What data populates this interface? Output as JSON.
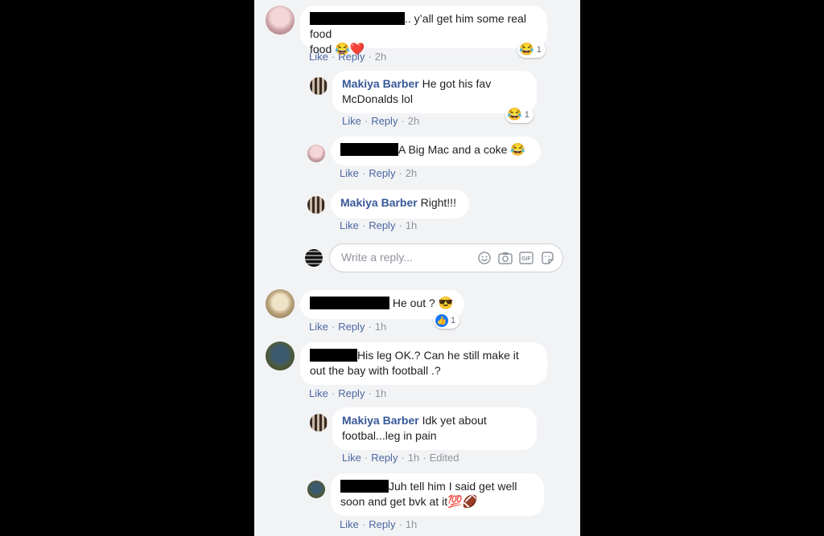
{
  "colors": {
    "page_bg": "#000000",
    "panel_bg": "#f2f3f5",
    "author": "#385898",
    "action": "#4b67a1",
    "meta": "#90949c"
  },
  "actions": {
    "like": "Like",
    "reply": "Reply",
    "separator": "·"
  },
  "comments": [
    {
      "text": ".. y’all get him some real food",
      "emoji": "😂❤️",
      "time": "2h",
      "reaction": {
        "icon": "laughing-emoji",
        "count": "1"
      }
    },
    {
      "author": "Makiya Barber",
      "text": "He got his fav McDonalds lol",
      "time": "2h",
      "reaction": {
        "icon": "laughing-emoji",
        "count": "1"
      }
    },
    {
      "text": "A Big Mac and a coke",
      "emoji": "😂",
      "time": "2h"
    },
    {
      "author": "Makiya Barber",
      "text": "Right!!!",
      "time": "1h"
    },
    {
      "text": "He out ?",
      "emoji": "😎",
      "time": "1h",
      "reaction": {
        "icon": "like-icon",
        "count": "1"
      }
    },
    {
      "text": "His leg OK.? Can he still make it out the bay with football .?",
      "time": "1h"
    },
    {
      "author": "Makiya Barber",
      "text": "Idk yet about footbal...leg in pain",
      "time": "1h",
      "edited": "Edited"
    },
    {
      "text": "Juh tell him I said get well soon and get bvk at it",
      "emoji": "💯🏈",
      "time": "1h"
    }
  ],
  "reply_box": {
    "placeholder": "Write a reply...",
    "icons": [
      "emoji-icon",
      "camera-icon",
      "gif-icon",
      "sticker-icon"
    ]
  }
}
